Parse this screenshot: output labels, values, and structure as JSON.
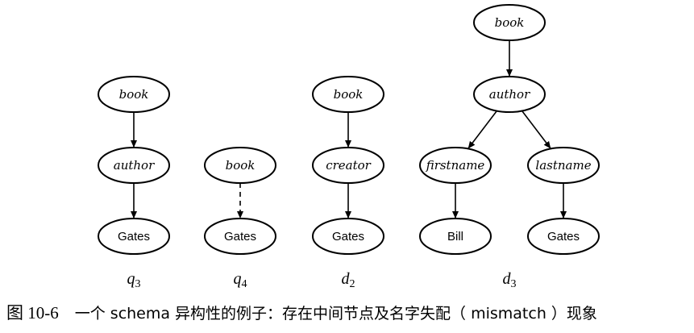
{
  "trees": [
    {
      "id": "q3",
      "label_base": "q",
      "label_sub": "3",
      "nodes": [
        {
          "id": "q3-book",
          "text": "book",
          "style": "italic"
        },
        {
          "id": "q3-author",
          "text": "author",
          "style": "italic"
        },
        {
          "id": "q3-gates",
          "text": "Gates",
          "style": "plain"
        }
      ],
      "edges": [
        {
          "from": "q3-book",
          "to": "q3-author",
          "type": "solid"
        },
        {
          "from": "q3-author",
          "to": "q3-gates",
          "type": "solid"
        }
      ]
    },
    {
      "id": "q4",
      "label_base": "q",
      "label_sub": "4",
      "nodes": [
        {
          "id": "q4-book",
          "text": "book",
          "style": "italic"
        },
        {
          "id": "q4-gates",
          "text": "Gates",
          "style": "plain"
        }
      ],
      "edges": [
        {
          "from": "q4-book",
          "to": "q4-gates",
          "type": "dashed"
        }
      ]
    },
    {
      "id": "d2",
      "label_base": "d",
      "label_sub": "2",
      "nodes": [
        {
          "id": "d2-book",
          "text": "book",
          "style": "italic"
        },
        {
          "id": "d2-creator",
          "text": "creator",
          "style": "italic"
        },
        {
          "id": "d2-gates",
          "text": "Gates",
          "style": "plain"
        }
      ],
      "edges": [
        {
          "from": "d2-book",
          "to": "d2-creator",
          "type": "solid"
        },
        {
          "from": "d2-creator",
          "to": "d2-gates",
          "type": "solid"
        }
      ]
    },
    {
      "id": "d3",
      "label_base": "d",
      "label_sub": "3",
      "nodes": [
        {
          "id": "d3-book",
          "text": "book",
          "style": "italic"
        },
        {
          "id": "d3-author",
          "text": "author",
          "style": "italic"
        },
        {
          "id": "d3-firstname",
          "text": "firstname",
          "style": "italic"
        },
        {
          "id": "d3-lastname",
          "text": "lastname",
          "style": "italic"
        },
        {
          "id": "d3-bill",
          "text": "Bill",
          "style": "plain"
        },
        {
          "id": "d3-gates",
          "text": "Gates",
          "style": "plain"
        }
      ],
      "edges": [
        {
          "from": "d3-book",
          "to": "d3-author",
          "type": "solid"
        },
        {
          "from": "d3-author",
          "to": "d3-firstname",
          "type": "solid"
        },
        {
          "from": "d3-author",
          "to": "d3-lastname",
          "type": "solid"
        },
        {
          "from": "d3-firstname",
          "to": "d3-bill",
          "type": "solid"
        },
        {
          "from": "d3-lastname",
          "to": "d3-gates",
          "type": "solid"
        }
      ]
    }
  ],
  "caption": {
    "figure_number": "图 10-6",
    "text": "一个 schema 异构性的例子：存在中间节点及名字失配（ mismatch ）现象"
  }
}
